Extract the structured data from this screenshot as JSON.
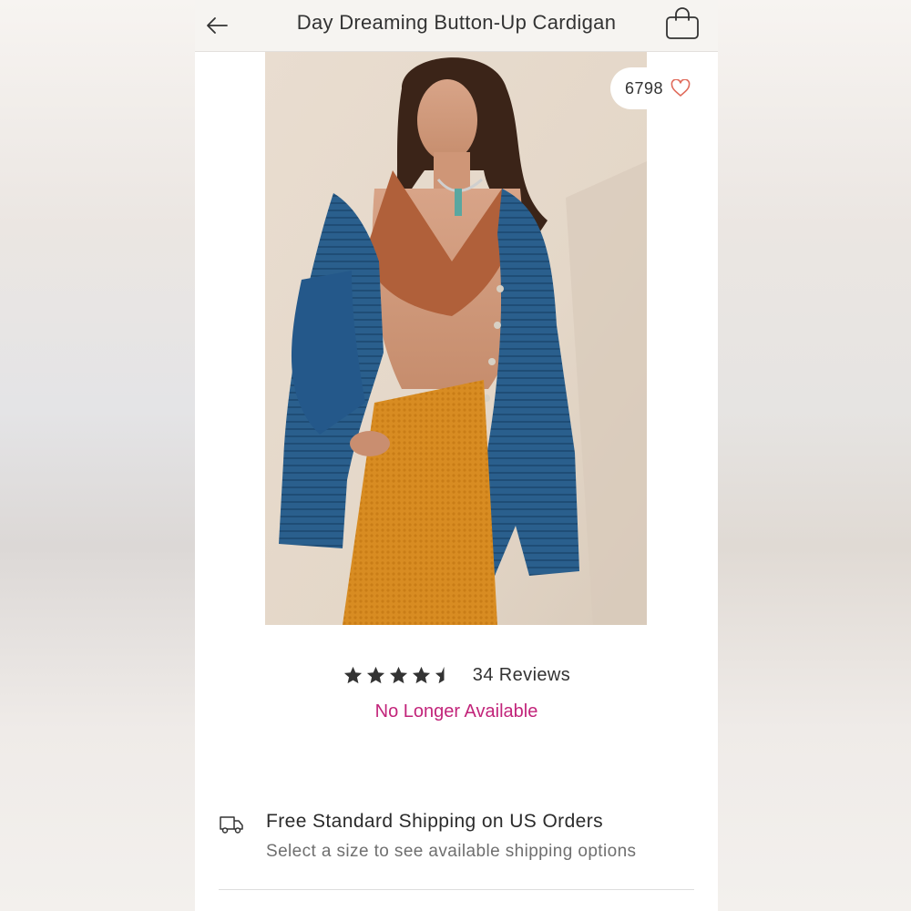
{
  "header": {
    "title": "Day Dreaming Button-Up Cardigan",
    "back_icon": "arrow-left-icon",
    "bag_icon": "shopping-bag-icon"
  },
  "product": {
    "image_alt": "Model wearing blue ribbed button-up cardigan over rust bralette with mustard knit pants",
    "likes": "6798",
    "like_icon": "heart-outline-icon",
    "rating": 4.5,
    "rating_max": 5,
    "reviews_label": "34 Reviews",
    "availability": "No Longer Available"
  },
  "shipping": {
    "icon": "truck-icon",
    "title": "Free Standard Shipping on US Orders",
    "subtitle": "Select a size to see available shipping options"
  },
  "colors": {
    "header_bg": "#f6f4f1",
    "availability": "#c2247a",
    "heart": "#e06a5a",
    "star": "#333333"
  }
}
